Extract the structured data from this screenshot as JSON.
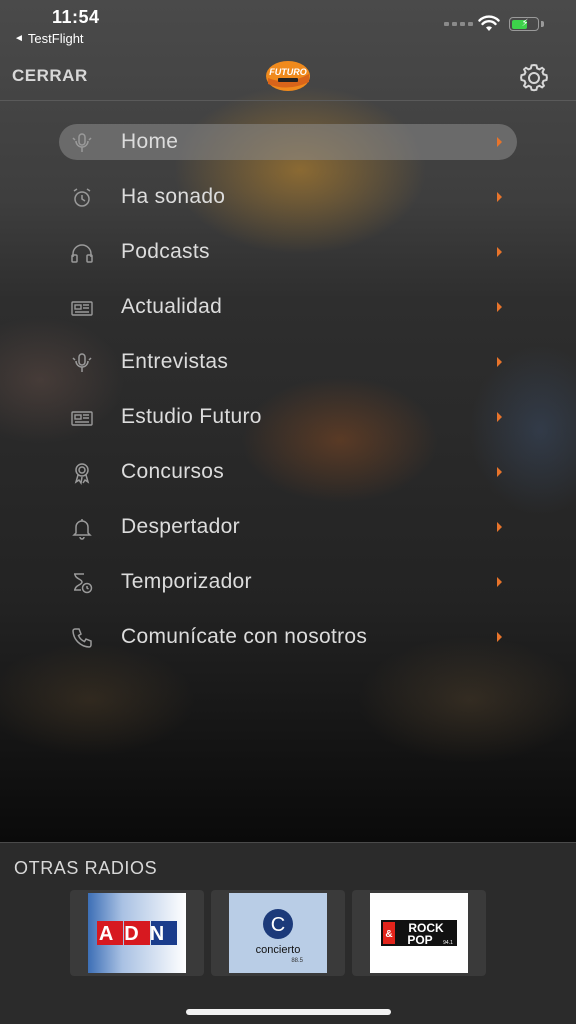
{
  "status_bar": {
    "time": "11:54",
    "back_app": "TestFlight",
    "back_indicator": "◄"
  },
  "header": {
    "close_label": "CERRAR",
    "logo_text": "FUTURO"
  },
  "menu": {
    "items": [
      {
        "label": "Home",
        "icon": "microphone-icon",
        "active": true
      },
      {
        "label": "Ha sonado",
        "icon": "alarm-clock-icon"
      },
      {
        "label": "Podcasts",
        "icon": "headphones-icon"
      },
      {
        "label": "Actualidad",
        "icon": "newspaper-icon"
      },
      {
        "label": "Entrevistas",
        "icon": "microphone-icon"
      },
      {
        "label": "Estudio Futuro",
        "icon": "newspaper-icon"
      },
      {
        "label": "Concursos",
        "icon": "award-icon"
      },
      {
        "label": "Despertador",
        "icon": "bell-icon"
      },
      {
        "label": "Temporizador",
        "icon": "hourglass-timer-icon"
      },
      {
        "label": "Comunícate con nosotros",
        "icon": "phone-icon"
      }
    ]
  },
  "other_radios": {
    "title": "OTRAS RADIOS",
    "stations": [
      {
        "name": "ADN",
        "logo_text": "ADN"
      },
      {
        "name": "Concierto",
        "logo_text": "concierto",
        "frequency": "88.5"
      },
      {
        "name": "Rock & Pop",
        "logo_text_1": "ROCK",
        "logo_text_2": "&",
        "logo_text_3": "POP",
        "frequency": "94.1"
      }
    ]
  },
  "colors": {
    "accent": "#e8742b",
    "menu_text": "#dcdcdc",
    "active_pill": "#8c8c8c"
  }
}
